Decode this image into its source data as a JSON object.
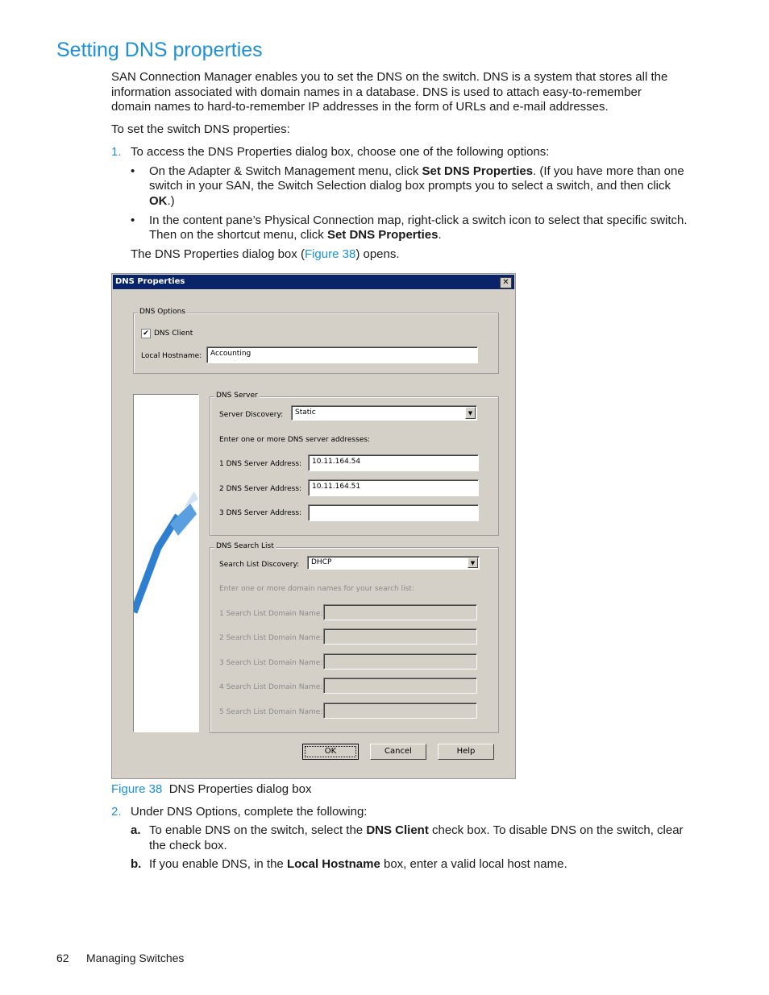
{
  "heading": "Setting DNS properties",
  "intro": [
    "SAN Connection Manager enables you to set the DNS on the switch. DNS is a system that stores all the",
    "information associated with domain names in a database. DNS is used to attach easy-to-remember",
    "domain names to hard-to-remember IP addresses in the form of URLs and e-mail addresses."
  ],
  "lead": "To set the switch DNS properties:",
  "step1": {
    "num": "1.",
    "text": "To access the DNS Properties dialog box, choose one of the following options:"
  },
  "bullet1": {
    "l1a": "On the Adapter & Switch Management menu, click ",
    "l1b": "Set DNS Properties",
    "l1c": ". (If you have more than one",
    "l2": "switch in your SAN, the Switch Selection dialog box prompts you to select a switch, and then click",
    "l3b": "OK",
    "l3c": ".)"
  },
  "bullet2": {
    "l1": "In the content pane’s Physical Connection map, right-click a switch icon to select that specific switch.",
    "l2a": "Then on the shortcut menu, click ",
    "l2b": "Set DNS Properties",
    "l2c": "."
  },
  "opens": {
    "a": "The DNS Properties dialog box (",
    "link": "Figure 38",
    "b": ") opens."
  },
  "dialog": {
    "title": "DNS Properties",
    "close": "✕",
    "dns_options": {
      "legend": "DNS Options",
      "dns_client_label": "DNS Client",
      "dns_client_checked": true,
      "check": "✔",
      "hostname_label": "Local Hostname:",
      "hostname_value": "Accounting"
    },
    "dns_server": {
      "legend": "DNS Server",
      "discovery_label": "Server Discovery:",
      "discovery_value": "Static",
      "instruction": "Enter one or more DNS server addresses:",
      "addresses": [
        {
          "label": "1 DNS Server Address:",
          "value": "10.11.164.54"
        },
        {
          "label": "2 DNS Server Address:",
          "value": "10.11.164.51"
        },
        {
          "label": "3 DNS Server Address:",
          "value": ""
        }
      ]
    },
    "search_list": {
      "legend": "DNS Search List",
      "discovery_label": "Search List Discovery:",
      "discovery_value": "DHCP",
      "instruction": "Enter one or more domain names for your search list:",
      "domains": [
        {
          "label": "1 Search List Domain Name:",
          "value": ""
        },
        {
          "label": "2 Search List Domain Name:",
          "value": ""
        },
        {
          "label": "3 Search List Domain Name:",
          "value": ""
        },
        {
          "label": "4 Search List Domain Name:",
          "value": ""
        },
        {
          "label": "5 Search List Domain Name:",
          "value": ""
        }
      ]
    },
    "buttons": {
      "ok": "OK",
      "cancel": "Cancel",
      "help": "Help"
    },
    "arrow": "▼"
  },
  "caption": {
    "num": "Figure 38",
    "text": "DNS Properties dialog box"
  },
  "step2": {
    "num": "2.",
    "text": "Under DNS Options, complete the following:"
  },
  "sub_a": {
    "num": "a.",
    "l1a": "To enable DNS on the switch, select the ",
    "l1b": "DNS Client",
    "l1c": " check box. To disable DNS on the switch, clear",
    "l2": "the check box."
  },
  "sub_b": {
    "num": "b.",
    "a": "If you enable DNS, in the ",
    "b": "Local Hostname",
    "c": " box, enter a valid local host name."
  },
  "footer": {
    "page": "62",
    "section": "Managing Switches"
  },
  "colors": {
    "accent": "#1e90d8",
    "titlebar": "#0a246a",
    "dialog_bg": "#d4d0c8"
  }
}
